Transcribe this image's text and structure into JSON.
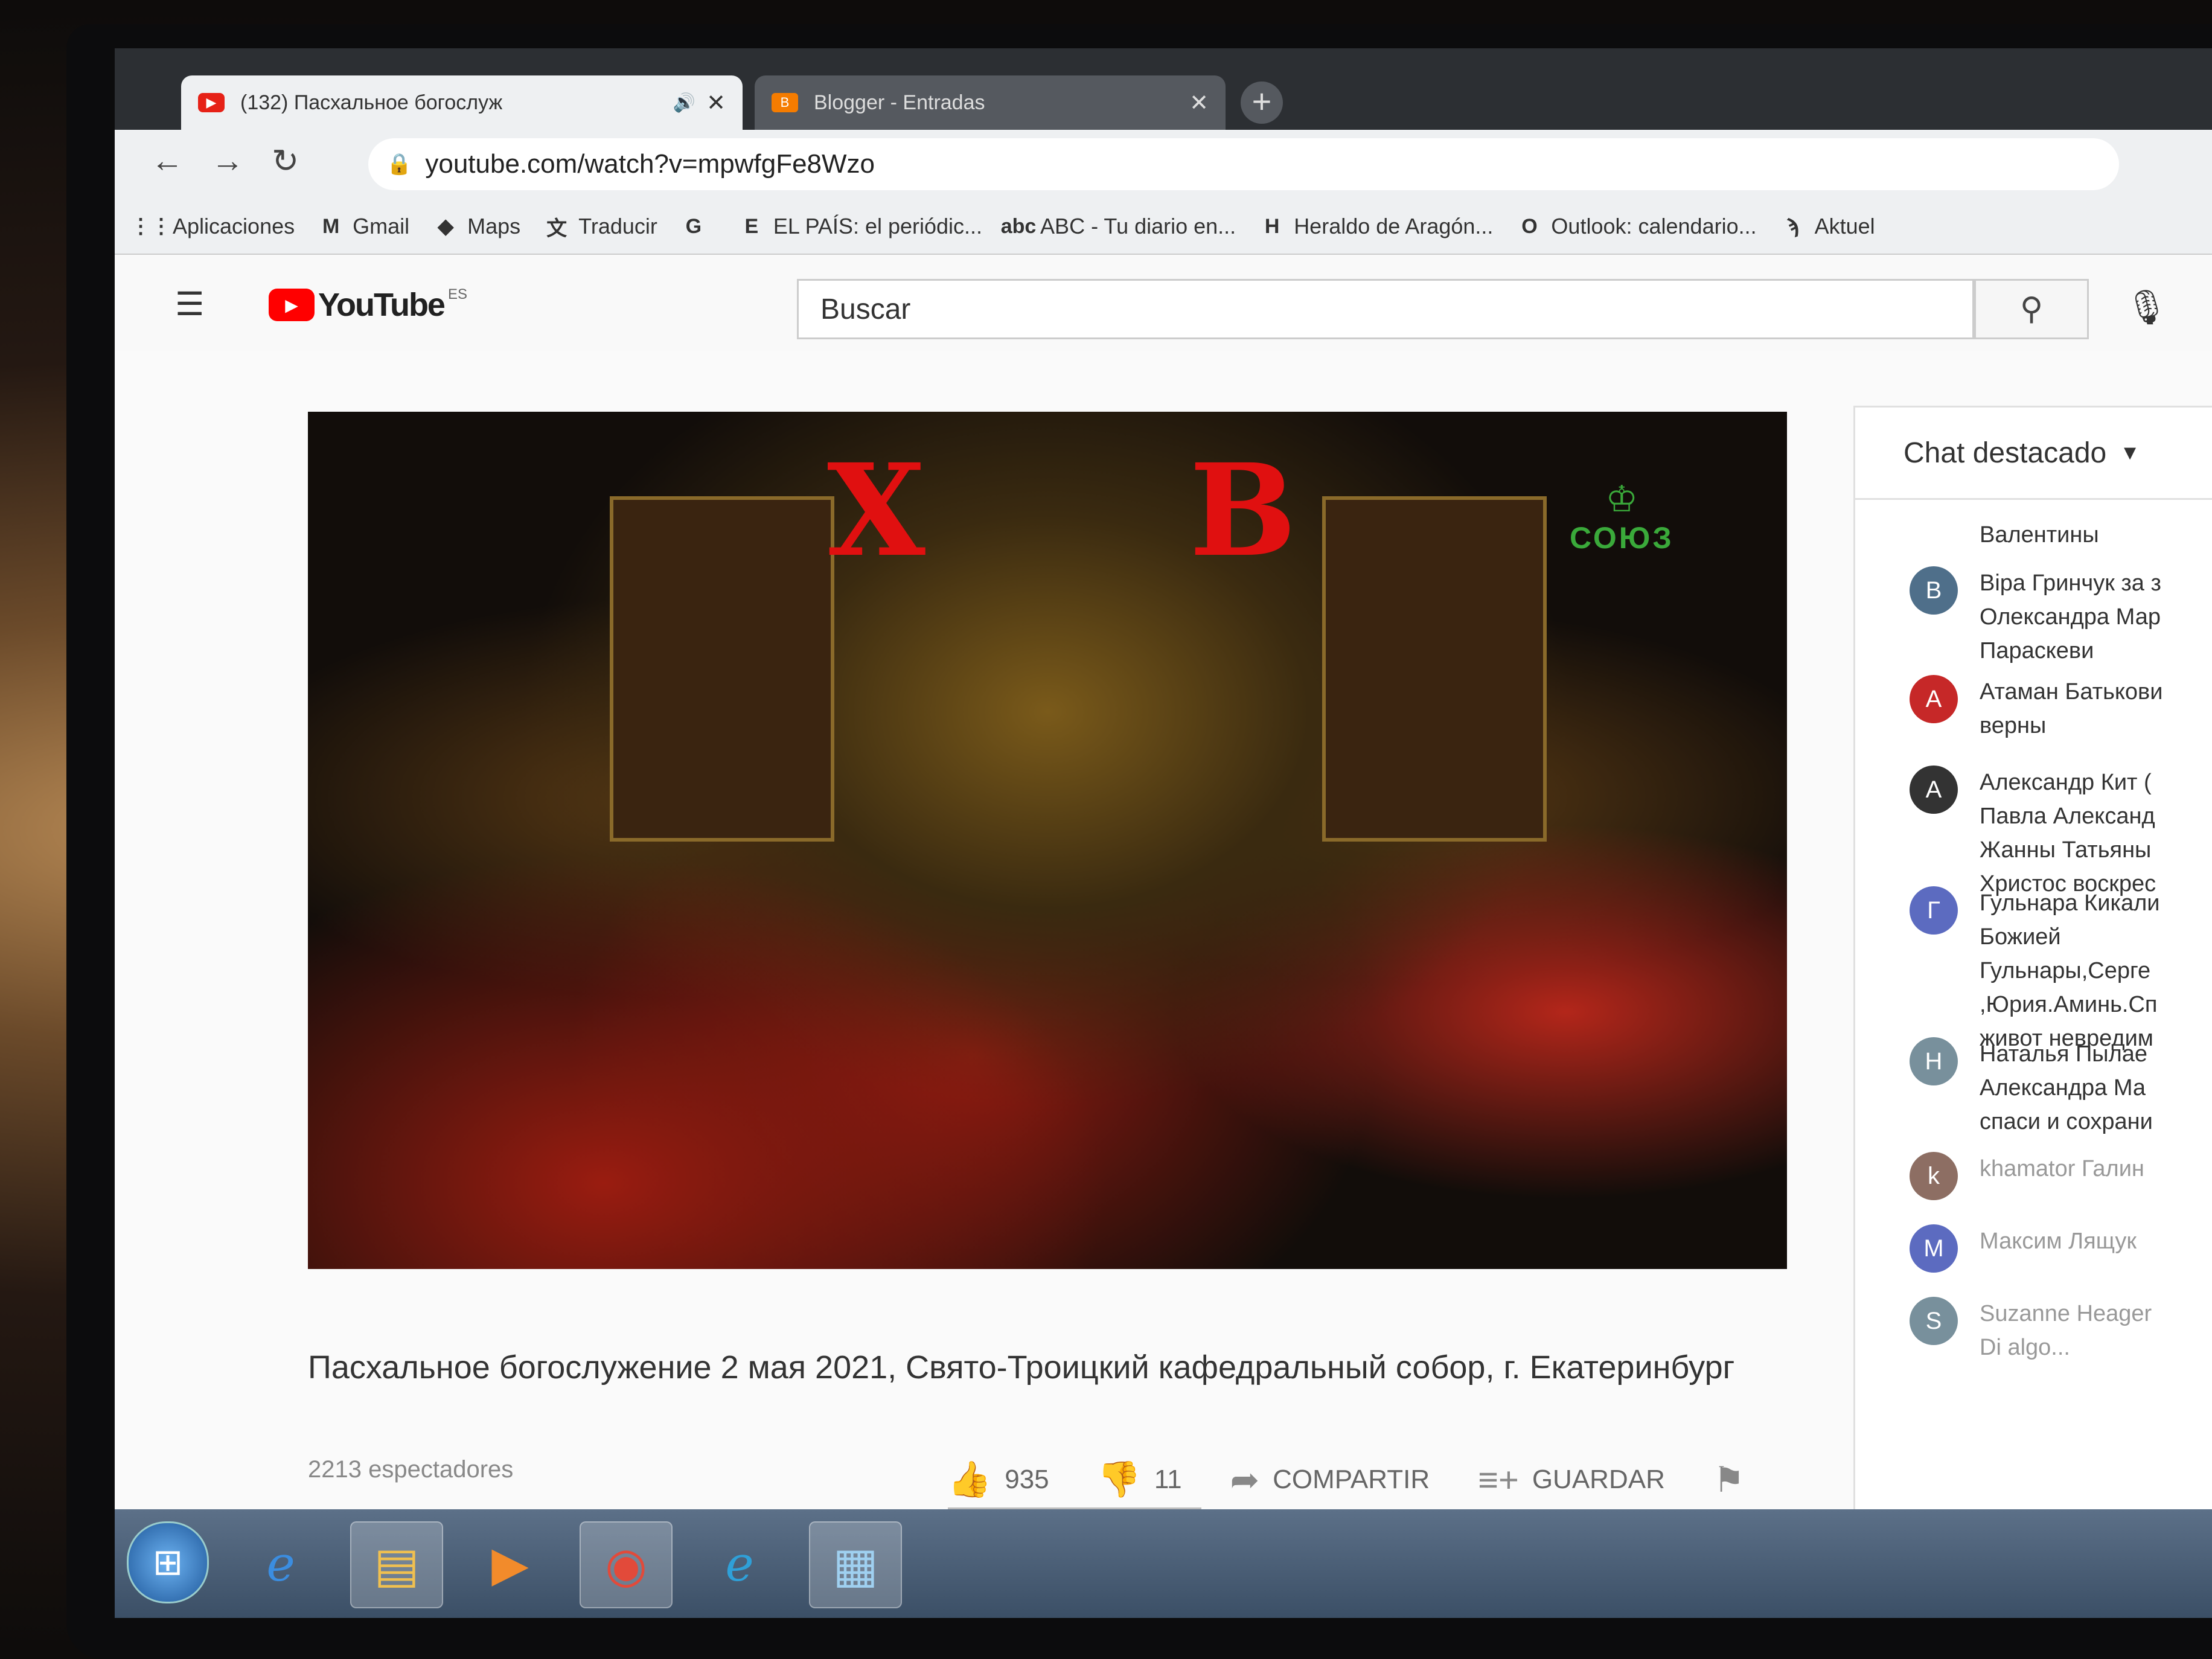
{
  "browser": {
    "tabs": [
      {
        "title": "(132) Пасхальное богослуж",
        "favicon": "youtube-favicon"
      },
      {
        "title": "Blogger - Entradas",
        "favicon": "blogger-favicon"
      }
    ],
    "new_tab_label": "+",
    "url": "youtube.com/watch?v=mpwfgFe8Wzo",
    "bookmarks": [
      {
        "label": "Aplicaciones",
        "icon": "apps-grid-icon",
        "glyph": "⋮⋮"
      },
      {
        "label": "Gmail",
        "icon": "gmail-icon",
        "glyph": "M"
      },
      {
        "label": "Maps",
        "icon": "maps-icon",
        "glyph": "◆"
      },
      {
        "label": "Traducir",
        "icon": "translate-icon",
        "glyph": "文"
      },
      {
        "label": "",
        "icon": "google-icon",
        "glyph": "G"
      },
      {
        "label": "EL PAÍS: el periódic...",
        "icon": "elpais-icon",
        "glyph": "E"
      },
      {
        "label": "ABC - Tu diario en...",
        "icon": "abc-icon",
        "glyph": "abc"
      },
      {
        "label": "Heraldo de Aragón...",
        "icon": "heraldo-icon",
        "glyph": "H"
      },
      {
        "label": "Outlook: calendario...",
        "icon": "outlook-icon",
        "glyph": "O"
      },
      {
        "label": "Aktuel",
        "icon": "aktuel-icon",
        "glyph": "ϡ"
      }
    ]
  },
  "youtube": {
    "logo_text": "YouTube",
    "region": "ES",
    "search_placeholder": "Buscar",
    "video_overlay": {
      "left_letter": "Х",
      "right_letter": "В",
      "channel_bug": "СОЮЗ"
    },
    "video_title": "Пасхальное богослужение 2 мая 2021, Свято-Троицкий кафедральный собор, г. Екатеринбург",
    "viewers": "2213 espectadores",
    "likes": "935",
    "dislikes": "11",
    "share_label": "COMPARTIR",
    "save_label": "GUARDAR"
  },
  "chat": {
    "header": "Chat destacado",
    "messages": [
      {
        "initial": "",
        "color": "#ffffff",
        "text": [
          "Валентины"
        ],
        "faded": false
      },
      {
        "initial": "В",
        "color": "#4f6f8a",
        "text": [
          "Віра Гринчук  за з",
          "Олександра Мар",
          "Параскеви"
        ],
        "faded": false
      },
      {
        "initial": "А",
        "color": "#c62828",
        "text": [
          "Атаман Батькови",
          "верны"
        ],
        "faded": false
      },
      {
        "initial": "А",
        "color": "#333333",
        "text": [
          "Александр Кит  (",
          "Павла Александ",
          "Жанны Татьяны",
          "Христос воскрес"
        ],
        "faded": false
      },
      {
        "initial": "Г",
        "color": "#5c6bc0",
        "text": [
          "Гульнара Кикали",
          "Божией",
          "Гульнары,Серге",
          ",Юрия.Аминь.Сп",
          "живот невредим"
        ],
        "faded": false
      },
      {
        "initial": "Н",
        "color": "#78909c",
        "text": [
          "Наталья Пылае",
          "Александра Ма",
          "спаси и сохрани"
        ],
        "faded": false
      },
      {
        "initial": "k",
        "color": "#8d6e63",
        "text": [
          "khamator  Галин"
        ],
        "faded": true
      },
      {
        "initial": "М",
        "color": "#5c6bc0",
        "text": [
          "Максим Лящук"
        ],
        "faded": true
      },
      {
        "initial": "S",
        "color": "#78909c",
        "text": [
          "Suzanne Heager",
          "Di algo..."
        ],
        "faded": true
      }
    ]
  },
  "taskbar": {
    "items": [
      "start-orb",
      "ie-icon",
      "explorer-icon",
      "media-player-icon",
      "chrome-icon",
      "edge-icon",
      "control-panel-icon"
    ]
  }
}
